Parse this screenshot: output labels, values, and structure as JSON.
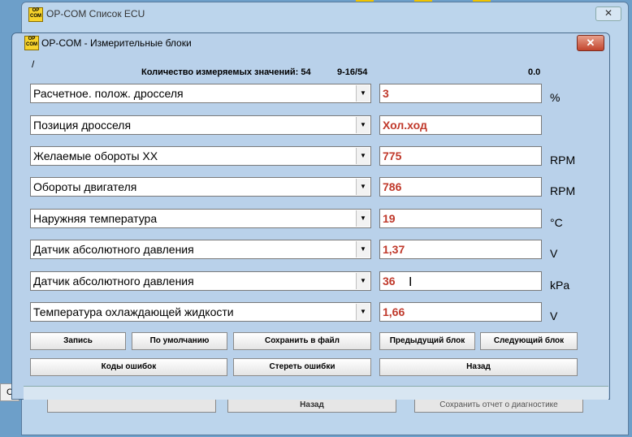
{
  "background_window": {
    "title": "OP-COM Список ECU",
    "close_label": "✕",
    "status_char": "С",
    "bottom_buttons": [
      "Назад",
      "Сохранить отчет о диагностике"
    ]
  },
  "window": {
    "title": "OP-COM - Измерительные блоки",
    "close_label": "✕",
    "logo_text": "OP COM"
  },
  "header": {
    "path": "/",
    "count_label": "Количество измеряемых значений: 54",
    "range": "9-16/54",
    "right_value": "0.0"
  },
  "rows": [
    {
      "label": "Расчетное. полож. дросселя",
      "value": "3",
      "unit": "%"
    },
    {
      "label": "Позиция дросселя",
      "value": "Хол.ход",
      "unit": ""
    },
    {
      "label": "Желаемые обороты ХХ",
      "value": "775",
      "unit": "RPM"
    },
    {
      "label": "Обороты двигателя",
      "value": "786",
      "unit": "RPM"
    },
    {
      "label": "Наружняя температура",
      "value": "19",
      "unit": "°C"
    },
    {
      "label": "Датчик абсолютного давления",
      "value": "1,37",
      "unit": "V"
    },
    {
      "label": "Датчик абсолютного давления",
      "value": "36",
      "unit": "kPa"
    },
    {
      "label": "Температура охлаждающей жидкости",
      "value": "1,66",
      "unit": "V"
    }
  ],
  "buttons": {
    "record": "Запись",
    "default": "По умолчанию",
    "save_file": "Сохранить в файл",
    "prev_block": "Предыдущий блок",
    "next_block": "Следующий блок",
    "error_codes": "Коды ошибок",
    "clear_errors": "Стереть ошибки",
    "back": "Назад"
  },
  "colors": {
    "value_text": "#c0392b",
    "window_bg": "#b9d1ea",
    "close_button": "#c2452e"
  }
}
